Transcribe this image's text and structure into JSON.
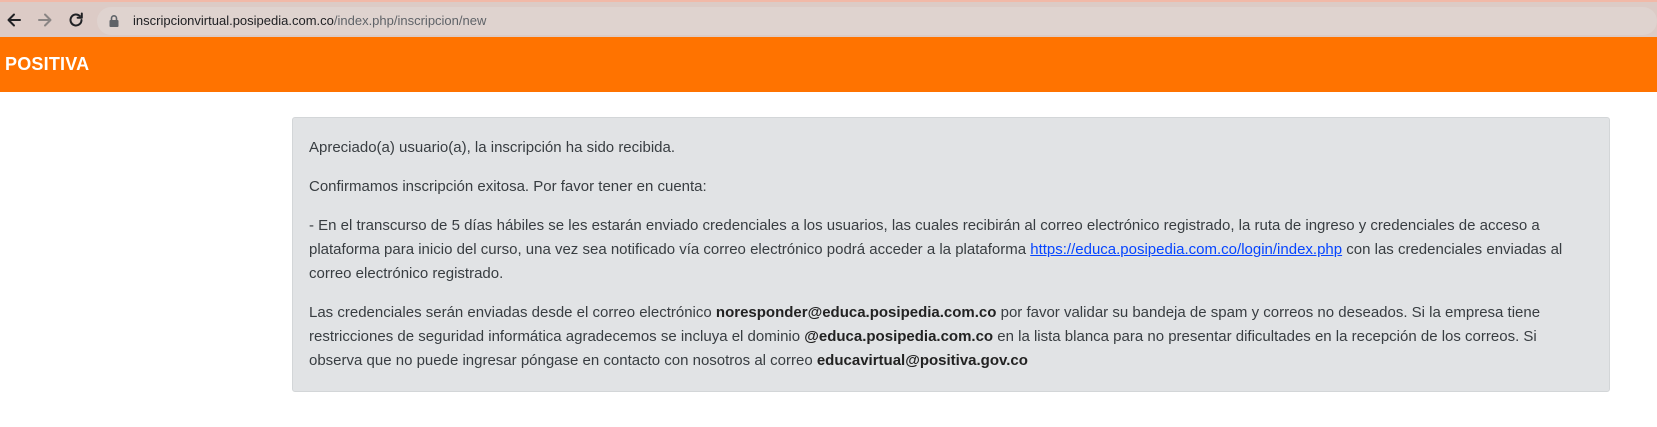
{
  "browser": {
    "url_host": "inscripcionvirtual.posipedia.com.co",
    "url_path": "/index.php/inscripcion/new"
  },
  "header": {
    "brand": "POSITIVA"
  },
  "message": {
    "line1": "Apreciado(a) usuario(a), la inscripción ha sido recibida.",
    "line2": "Confirmamos inscripción exitosa. Por favor tener en cuenta:",
    "para3_before": "- En el transcurso de 5 días hábiles se les estarán enviado credenciales a los usuarios, las cuales recibirán al correo electrónico registrado, la ruta de ingreso y credenciales de acceso a plataforma para inicio del curso, una vez sea notificado vía correo electrónico podrá acceder a la plataforma ",
    "para3_link": "https://educa.posipedia.com.co/login/index.php",
    "para3_after": " con las credenciales enviadas al correo electrónico registrado.",
    "para4_a": "Las credenciales serán enviadas desde el correo electrónico ",
    "para4_email1": "noresponder@educa.posipedia.com.co",
    "para4_b": " por favor validar su bandeja de spam y correos no deseados. Si la empresa tiene restricciones de seguridad informática agradecemos se incluya el dominio ",
    "para4_domain": "@educa.posipedia.com.co",
    "para4_c": " en la lista blanca para no presentar dificultades en la recepción de los correos. Si observa que no puede ingresar póngase en contacto con nosotros al correo ",
    "para4_email2": "educavirtual@positiva.gov.co"
  },
  "colors": {
    "header_bg": "#ff7300",
    "browser_bar_bg": "#dccbc6",
    "message_bg": "#e1e3e5",
    "link": "#0645ff"
  },
  "icons": {
    "back": "arrow-left-icon",
    "forward": "arrow-right-icon",
    "reload": "reload-icon",
    "lock": "lock-icon"
  }
}
